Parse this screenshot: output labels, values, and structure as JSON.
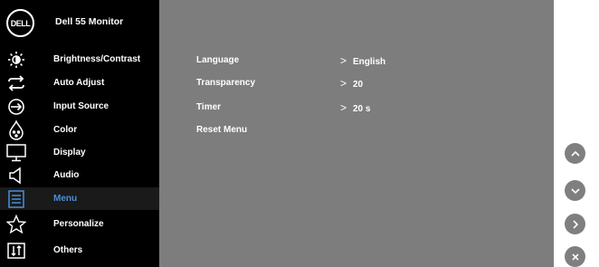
{
  "header": {
    "logo_text": "DELL",
    "title": "Dell 55 Monitor"
  },
  "sidebar": {
    "items": [
      {
        "label": "Brightness/Contrast",
        "icon": "brightness-icon"
      },
      {
        "label": "Auto Adjust",
        "icon": "auto-adjust-icon"
      },
      {
        "label": "Input Source",
        "icon": "input-source-icon"
      },
      {
        "label": "Color",
        "icon": "color-icon"
      },
      {
        "label": "Display",
        "icon": "display-icon"
      },
      {
        "label": "Audio",
        "icon": "audio-icon"
      },
      {
        "label": "Menu",
        "icon": "menu-icon",
        "selected": true
      },
      {
        "label": "Personalize",
        "icon": "star-icon"
      },
      {
        "label": "Others",
        "icon": "others-icon"
      }
    ]
  },
  "menu_settings": [
    {
      "label": "Language",
      "value": "English"
    },
    {
      "label": "Transparency",
      "value": "20"
    },
    {
      "label": "Timer",
      "value": "20 s"
    },
    {
      "label": "Reset Menu",
      "value": ""
    }
  ],
  "nav_buttons": [
    "up-button",
    "down-button",
    "right-button",
    "close-button"
  ],
  "colors": {
    "sidebar_bg": "#000000",
    "content_bg": "#7d7d7d",
    "selected_text": "#4a8fd8",
    "nav_bg": "#7f7f7f"
  }
}
